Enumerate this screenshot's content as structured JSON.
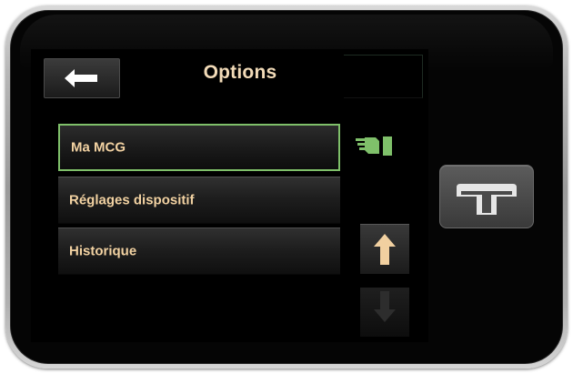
{
  "header": {
    "title": "Options",
    "back_icon": "left-arrow-icon"
  },
  "menu": {
    "items": [
      {
        "label": "Ma MCG",
        "selected": true
      },
      {
        "label": "Réglages dispositif",
        "selected": false
      },
      {
        "label": "Historique",
        "selected": false
      }
    ]
  },
  "status": {
    "cgm_icon": "cgm-transmitter-icon",
    "cgm_color": "#7fc06a"
  },
  "scroll": {
    "up_icon": "up-arrow-icon",
    "down_icon": "down-arrow-icon",
    "up_enabled": true,
    "down_enabled": false
  },
  "hardware": {
    "logo_icon": "t-logo-icon"
  },
  "colors": {
    "text": "#f2d2a2",
    "selected_border": "#7fc06a",
    "screen": "#000000"
  }
}
